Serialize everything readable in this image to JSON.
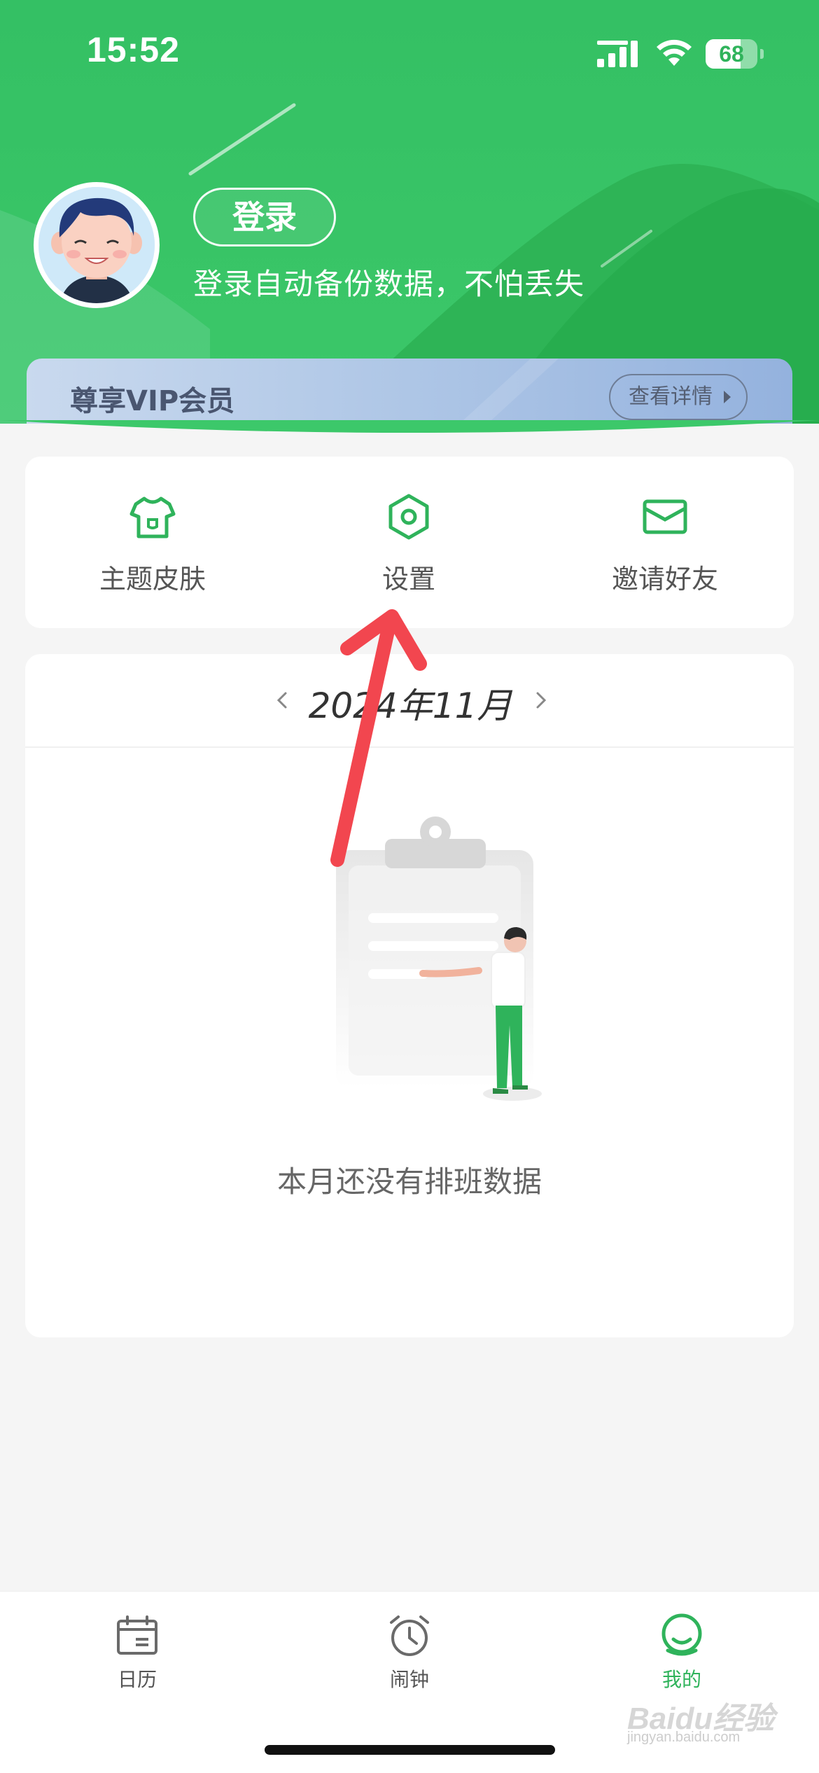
{
  "status_bar": {
    "time": "15:52",
    "battery_level": "68",
    "battery_fraction": 0.68
  },
  "profile": {
    "login_label": "登录",
    "subtitle": "登录自动备份数据，不怕丢失"
  },
  "vip": {
    "title": "尊享VIP会员",
    "detail_label": "查看详情"
  },
  "quick_menu": [
    {
      "label": "主题皮肤",
      "icon": "tshirt-icon"
    },
    {
      "label": "设置",
      "icon": "gear-icon"
    },
    {
      "label": "邀请好友",
      "icon": "envelope-icon"
    }
  ],
  "calendar": {
    "month_title": "2024年11月",
    "empty_message": "本月还没有排班数据"
  },
  "tabs": [
    {
      "label": "日历",
      "icon": "calendar-icon",
      "active": false
    },
    {
      "label": "闹钟",
      "icon": "alarm-clock-icon",
      "active": false
    },
    {
      "label": "我的",
      "icon": "profile-face-icon",
      "active": true
    }
  ],
  "watermark": {
    "text": "Baidu经验",
    "sub": "jingyan.baidu.com"
  },
  "colors": {
    "brand_green": "#2fb35b",
    "annotation_red": "#f2464f",
    "vip_text": "#4a5670"
  }
}
